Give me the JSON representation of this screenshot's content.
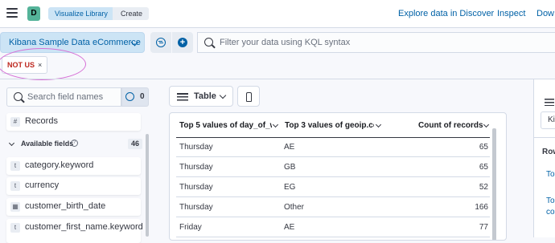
{
  "header": {
    "app_initial": "D",
    "breadcrumbs": [
      "Visualize Library",
      "Create"
    ],
    "links": [
      "Explore data in Discover",
      "Inspect",
      "Dow"
    ]
  },
  "query": {
    "data_view": "Kibana Sample Data eCommerce",
    "placeholder": "Filter your data using KQL syntax",
    "filter_pill": "NOT US",
    "filter_pill_close": "×"
  },
  "sidebar": {
    "search_placeholder": "Search field names",
    "filter_count": "0",
    "records_label": "Records",
    "available_label": "Available fields",
    "available_count": "46",
    "fields": [
      {
        "type": "t",
        "name": "category.keyword"
      },
      {
        "type": "t",
        "name": "currency"
      },
      {
        "type": "cal",
        "name": "customer_birth_date"
      },
      {
        "type": "t",
        "name": "customer_first_name.keyword"
      }
    ]
  },
  "workspace": {
    "viz_type": "Table",
    "columns": [
      "Top 5 values of day_of_w",
      "Top 3 values of geoip.co",
      "Count of records"
    ],
    "rows": [
      [
        "Thursday",
        "AE",
        "65"
      ],
      [
        "Thursday",
        "GB",
        "65"
      ],
      [
        "Thursday",
        "EG",
        "52"
      ],
      [
        "Thursday",
        "Other",
        "166"
      ],
      [
        "Friday",
        "AE",
        "77"
      ]
    ]
  },
  "config_panel": {
    "input_partial": "Ki",
    "row_partial": "Row",
    "item1": "To",
    "item2_line1": "To",
    "item2_line2": "co"
  }
}
